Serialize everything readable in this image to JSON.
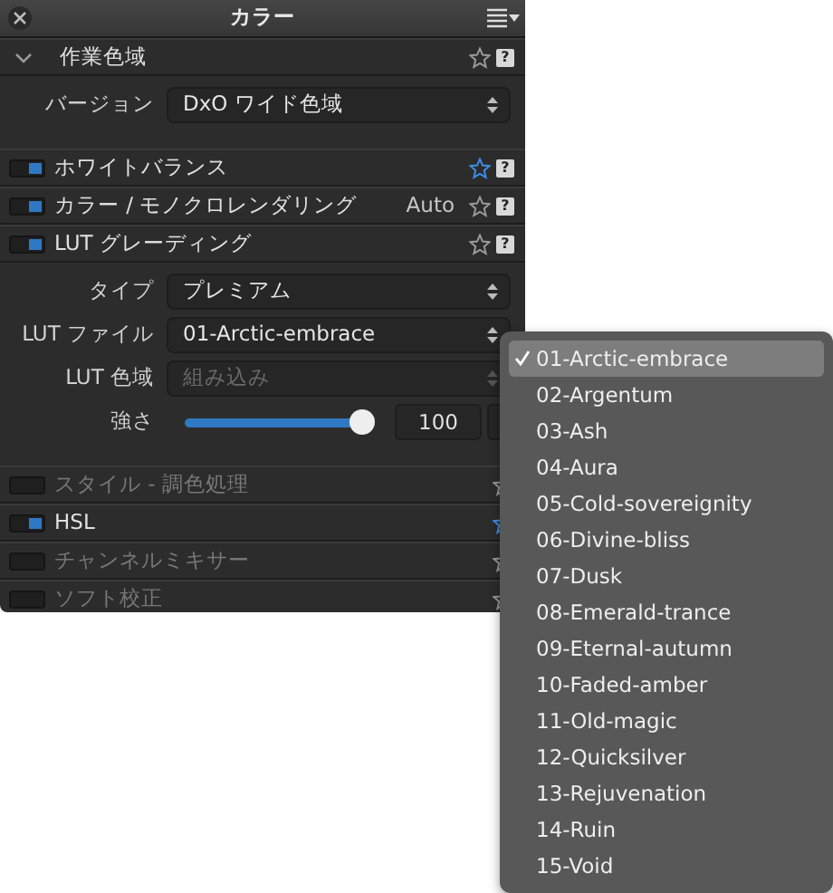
{
  "title": "カラー",
  "sections": [
    {
      "kind": "group",
      "label": "作業色域",
      "expanded": true,
      "favorite": false,
      "help": "?",
      "fields": [
        {
          "kind": "select",
          "label": "バージョン",
          "value": "DxO ワイド色域",
          "disabled": false
        }
      ]
    },
    {
      "kind": "tool",
      "label": "ホワイトバランス",
      "on": true,
      "favorite": true,
      "help": "?"
    },
    {
      "kind": "tool",
      "label": "カラー / モノクロレンダリング",
      "on": true,
      "favorite": false,
      "value": "Auto",
      "help": "?"
    },
    {
      "kind": "tool",
      "label": "LUT グレーディング",
      "on": true,
      "favorite": false,
      "help": "?",
      "fields": [
        {
          "kind": "select",
          "label": "タイプ",
          "value": "プレミアム",
          "disabled": false
        },
        {
          "kind": "select",
          "label": "LUT ファイル",
          "value": "01-Arctic-embrace",
          "disabled": false
        },
        {
          "kind": "select",
          "label": "LUT 色域",
          "value": "組み込み",
          "disabled": true
        },
        {
          "kind": "slider",
          "label": "強さ",
          "level": 1,
          "value": "100"
        }
      ]
    },
    {
      "kind": "tool",
      "label": "スタイル - 調色処理",
      "on": false,
      "favorite": false
    },
    {
      "kind": "tool",
      "label": "HSL",
      "on": true,
      "favorite": true
    },
    {
      "kind": "tool",
      "label": "チャンネルミキサー",
      "on": false,
      "favorite": false
    },
    {
      "kind": "tool",
      "label": "ソフト校正",
      "on": false,
      "favorite": false
    }
  ],
  "menu": {
    "items": [
      {
        "label": "01-Arctic-embrace",
        "selected": true
      },
      {
        "label": "02-Argentum",
        "selected": false
      },
      {
        "label": "03-Ash",
        "selected": false
      },
      {
        "label": "04-Aura",
        "selected": false
      },
      {
        "label": "05-Cold-sovereignity",
        "selected": false
      },
      {
        "label": "06-Divine-bliss",
        "selected": false
      },
      {
        "label": "07-Dusk",
        "selected": false
      },
      {
        "label": "08-Emerald-trance",
        "selected": false
      },
      {
        "label": "09-Eternal-autumn",
        "selected": false
      },
      {
        "label": "10-Faded-amber",
        "selected": false
      },
      {
        "label": "11-Old-magic",
        "selected": false
      },
      {
        "label": "12-Quicksilver",
        "selected": false
      },
      {
        "label": "13-Rejuvenation",
        "selected": false
      },
      {
        "label": "14-Ruin",
        "selected": false
      },
      {
        "label": "15-Void",
        "selected": false
      }
    ]
  }
}
